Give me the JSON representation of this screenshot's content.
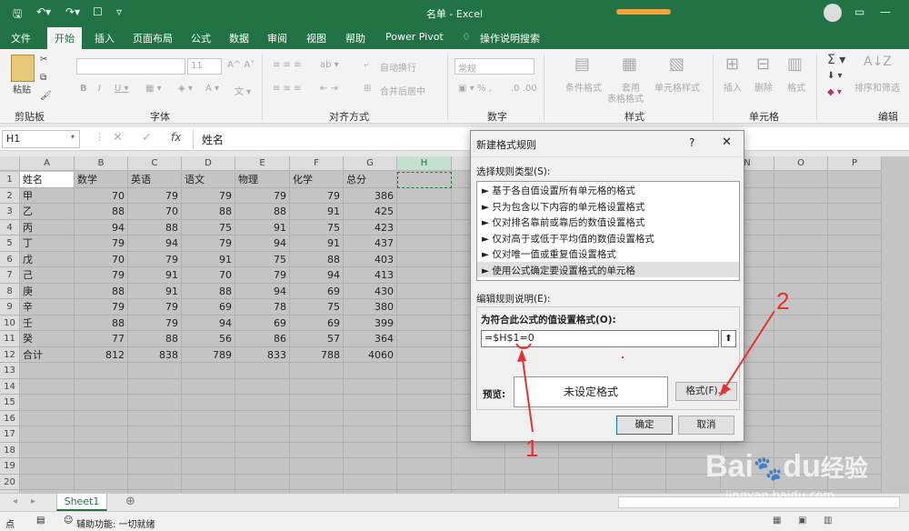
{
  "window": {
    "title": "名单 - Excel"
  },
  "tabs": [
    "文件",
    "开始",
    "插入",
    "页面布局",
    "公式",
    "数据",
    "审阅",
    "视图",
    "帮助",
    "Power Pivot",
    "操作说明搜索"
  ],
  "ribbon": {
    "groups": [
      "剪贴板",
      "字体",
      "对齐方式",
      "数字",
      "样式",
      "单元格",
      "编辑"
    ],
    "paste": "粘贴",
    "font_size": "11",
    "wrap": "自动换行",
    "merge": "合并后居中",
    "number_format": "常规",
    "cond_format": "条件格式",
    "table_format_1": "套用",
    "table_format_2": "表格格式",
    "cell_styles": "单元格样式",
    "insert": "插入",
    "delete": "删除",
    "format": "格式",
    "sort_filter": "排序和筛选",
    "find_select": "查找和选择"
  },
  "formula_bar": {
    "name_box": "H1",
    "value": "姓名"
  },
  "columns": [
    "A",
    "B",
    "C",
    "D",
    "E",
    "F",
    "G",
    "H",
    "I",
    "J",
    "K",
    "L",
    "M",
    "N",
    "O",
    "P"
  ],
  "rows": [
    [
      "姓名",
      "数学",
      "英语",
      "语文",
      "物理",
      "化学",
      "总分"
    ],
    [
      "甲",
      "70",
      "79",
      "79",
      "79",
      "79",
      "386"
    ],
    [
      "乙",
      "88",
      "70",
      "88",
      "88",
      "91",
      "425"
    ],
    [
      "丙",
      "94",
      "88",
      "75",
      "91",
      "75",
      "423"
    ],
    [
      "丁",
      "79",
      "94",
      "79",
      "94",
      "91",
      "437"
    ],
    [
      "戊",
      "70",
      "79",
      "91",
      "75",
      "88",
      "403"
    ],
    [
      "己",
      "79",
      "91",
      "70",
      "79",
      "94",
      "413"
    ],
    [
      "庚",
      "88",
      "91",
      "88",
      "94",
      "69",
      "430"
    ],
    [
      "辛",
      "79",
      "79",
      "69",
      "78",
      "75",
      "380"
    ],
    [
      "壬",
      "88",
      "79",
      "94",
      "69",
      "69",
      "399"
    ],
    [
      "癸",
      "77",
      "88",
      "56",
      "86",
      "57",
      "364"
    ],
    [
      "合计",
      "812",
      "838",
      "789",
      "833",
      "788",
      "4060"
    ]
  ],
  "row_numbers": [
    "1",
    "2",
    "3",
    "4",
    "5",
    "6",
    "7",
    "8",
    "9",
    "10",
    "11",
    "12",
    "13",
    "14",
    "15",
    "16",
    "17",
    "18",
    "19",
    "20",
    "21",
    "22"
  ],
  "sheet_tab": "Sheet1",
  "status": {
    "text": "点",
    "accessibility": "辅助功能: 一切就绪"
  },
  "dialog": {
    "title": "新建格式规则",
    "help": "?",
    "close": "✕",
    "rule_type_label": "选择规则类型(S):",
    "rule_types": [
      "► 基于各自值设置所有单元格的格式",
      "► 只为包含以下内容的单元格设置格式",
      "► 仅对排名靠前或靠后的数值设置格式",
      "► 仅对高于或低于平均值的数值设置格式",
      "► 仅对唯一值或重复值设置格式",
      "► 使用公式确定要设置格式的单元格"
    ],
    "edit_label": "编辑规则说明(E):",
    "formula_label": "为符合此公式的值设置格式(O):",
    "formula_value": "=$H$1=0",
    "preview_label": "预览:",
    "preview_text": "未设定格式",
    "format_button": "格式(F)...",
    "ok": "确定",
    "cancel": "取消"
  },
  "annotations": {
    "one": "1",
    "two": "2"
  },
  "watermark": {
    "brand": "Bai",
    "brand_du": "du",
    "brand_cn": "经验",
    "url": "jingyan.baidu.com"
  },
  "colors": {
    "excel_green": "#217346",
    "arrow_red": "#e8312f"
  }
}
